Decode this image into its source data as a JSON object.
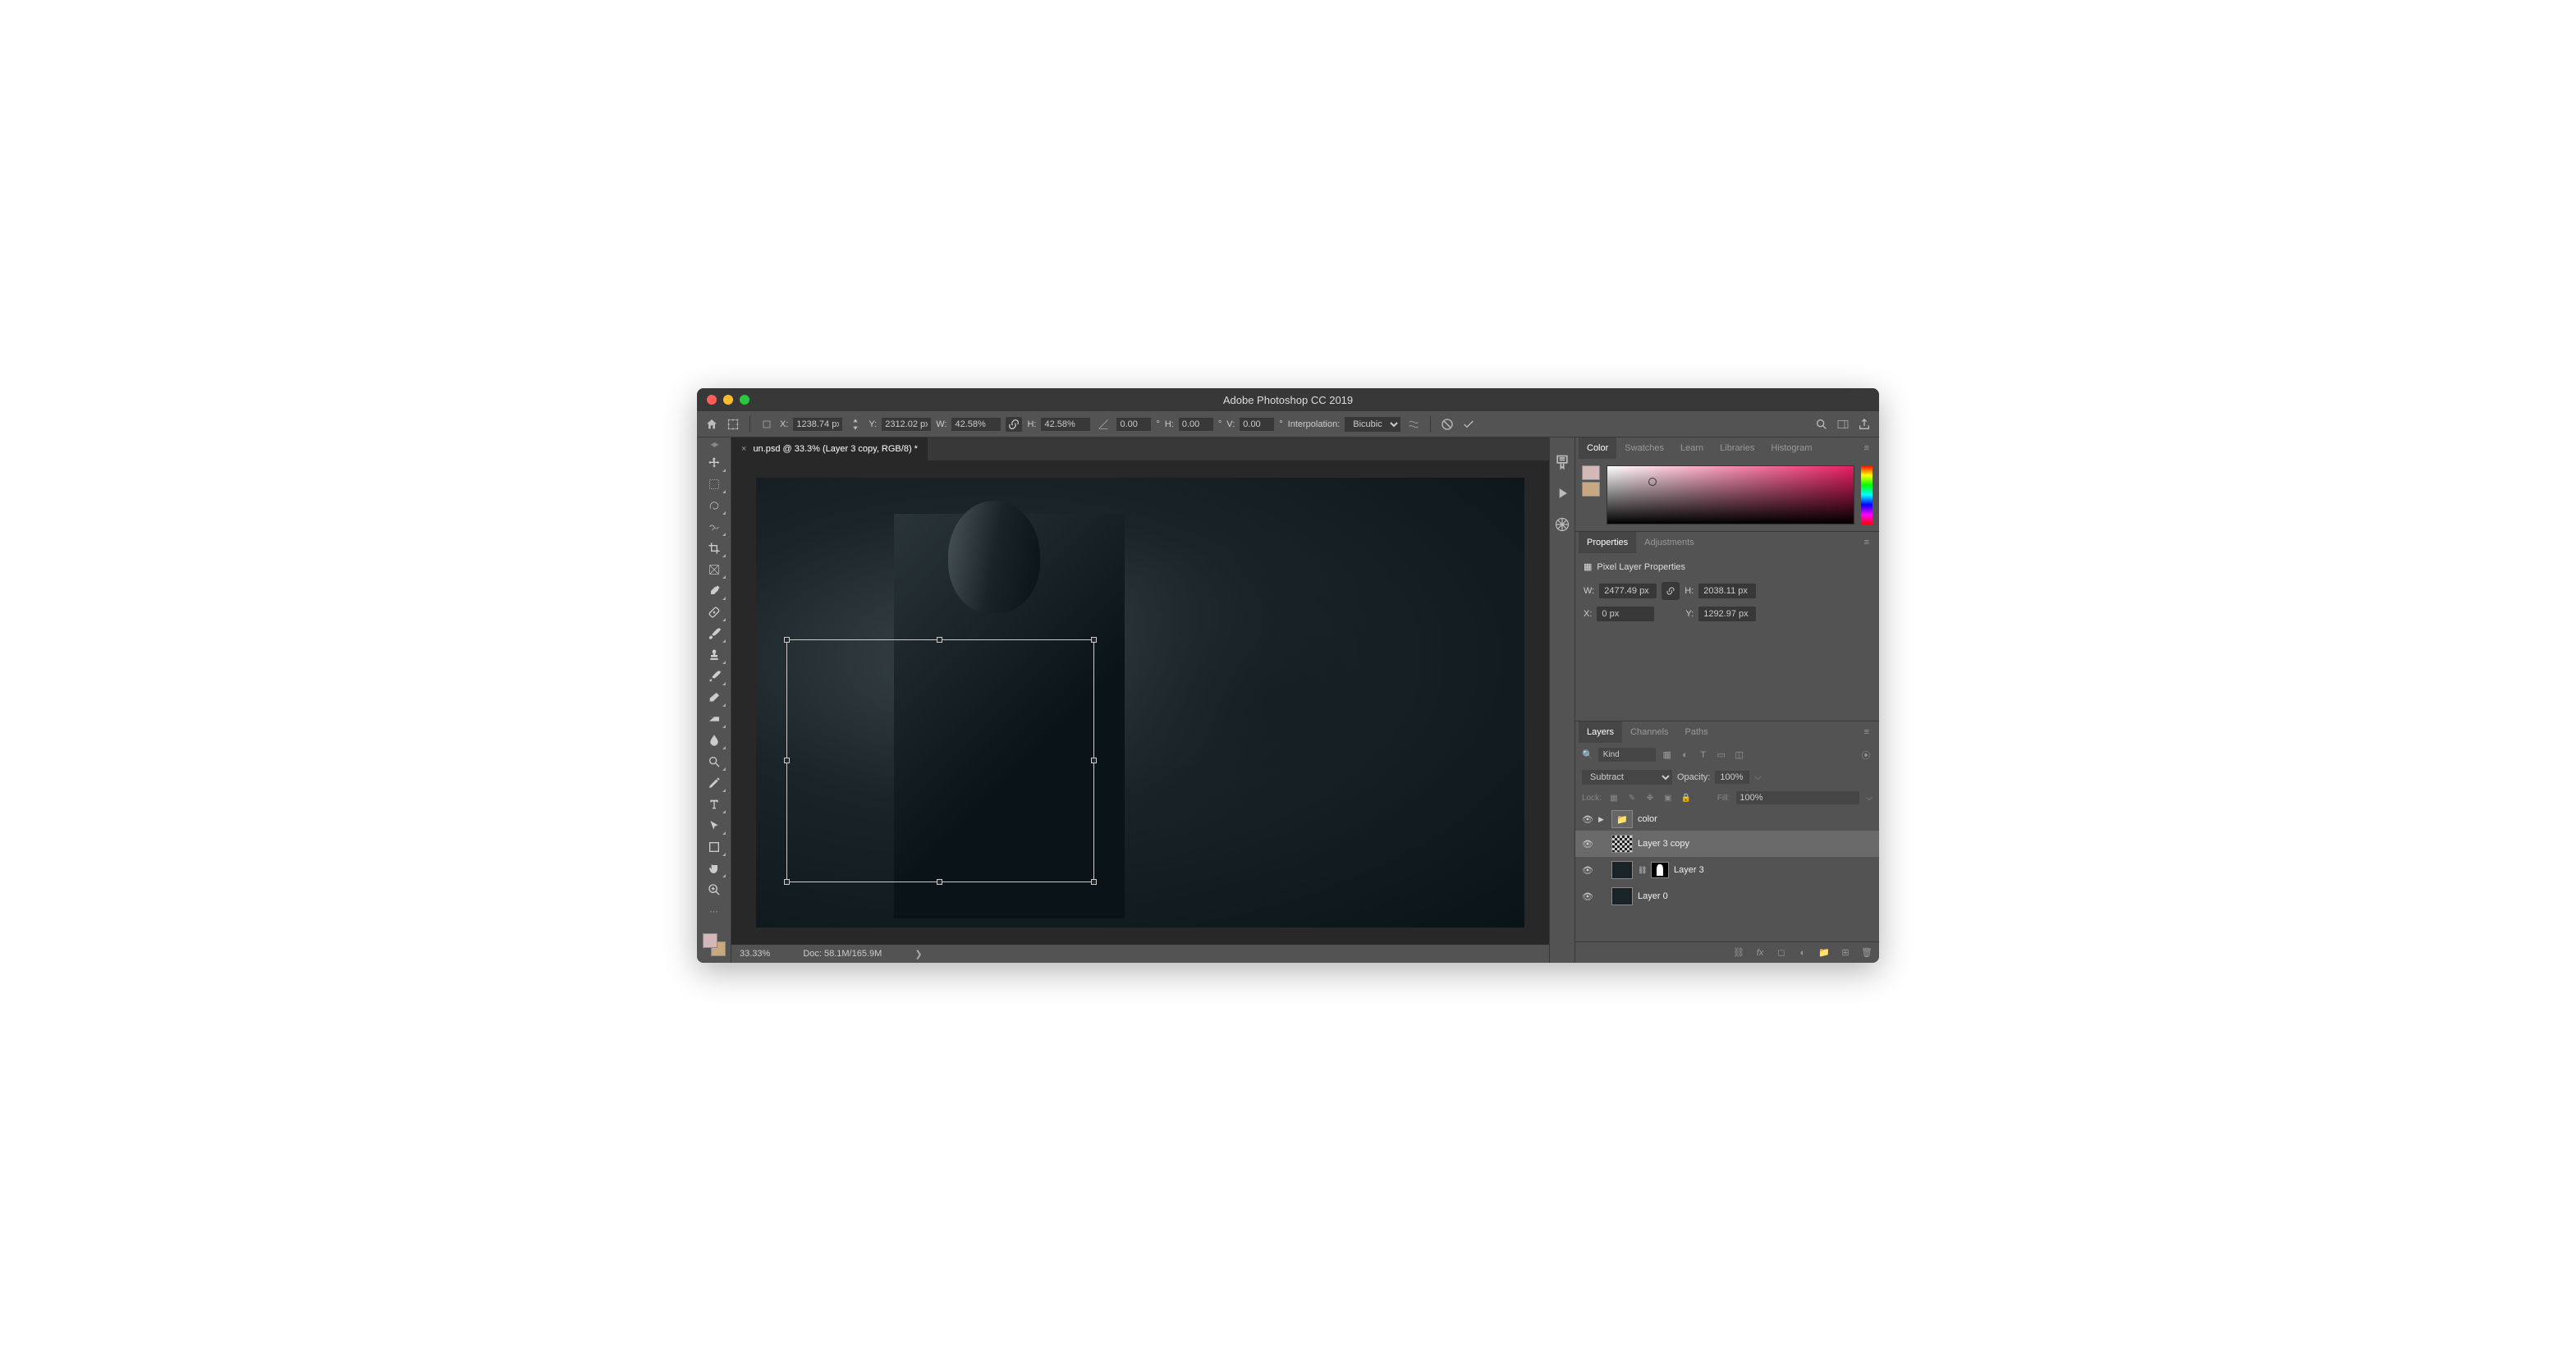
{
  "title": "Adobe Photoshop CC 2019",
  "opt": {
    "x": "1238.74 px",
    "y": "2312.02 px",
    "w": "42.58%",
    "h": "42.58%",
    "angle": "0.00",
    "skewH": "0.00",
    "skewV": "0.00",
    "interpLabel": "Interpolation:",
    "interp": "Bicubic"
  },
  "tab": {
    "label": "un.psd @ 33.3% (Layer 3 copy, RGB/8) *"
  },
  "status": {
    "zoom": "33.33%",
    "doc": "Doc: 58.1M/165.9M"
  },
  "panelTabs": {
    "color": "Color",
    "swatches": "Swatches",
    "learn": "Learn",
    "libraries": "Libraries",
    "histogram": "Histogram",
    "properties": "Properties",
    "adjustments": "Adjustments",
    "layers": "Layers",
    "channels": "Channels",
    "paths": "Paths"
  },
  "props": {
    "title": "Pixel Layer Properties",
    "w": "2477.49 px",
    "h": "2038.11 px",
    "x": "0 px",
    "y": "1292.97 px"
  },
  "layersPanel": {
    "filterKind": "Kind",
    "blend": "Subtract",
    "opacityLbl": "Opacity:",
    "opacity": "100%",
    "lockLbl": "Lock:",
    "fillLbl": "Fill:",
    "fill": "100%"
  },
  "layers": [
    {
      "name": "color",
      "type": "group"
    },
    {
      "name": "Layer 3 copy",
      "type": "layer",
      "selected": true
    },
    {
      "name": "Layer 3",
      "type": "masked"
    },
    {
      "name": "Layer 0",
      "type": "layer"
    }
  ],
  "labels": {
    "X": "X:",
    "Y": "Y:",
    "W": "W:",
    "H": "H:",
    "Hs": "H:",
    "Vs": "V:"
  }
}
